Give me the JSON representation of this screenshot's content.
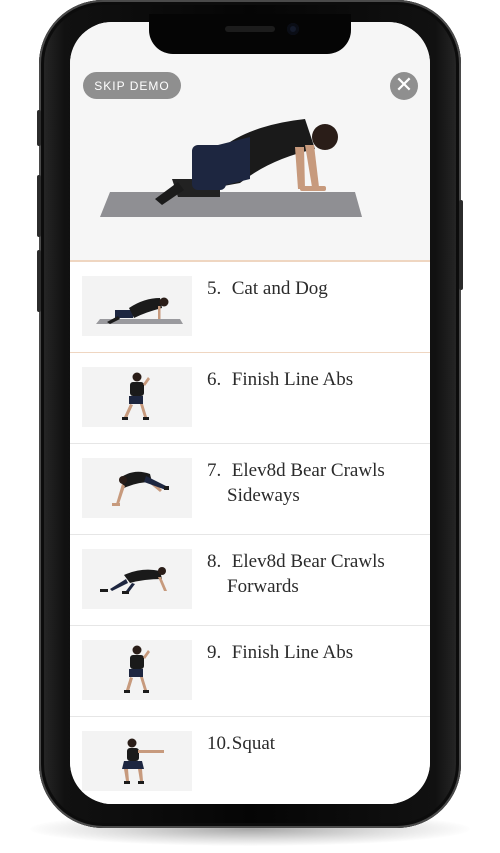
{
  "hero": {
    "skip_label": "SKIP DEMO",
    "close_icon": "close-icon",
    "current_exercise_icon": "person-cat-dog-pose"
  },
  "exercises": [
    {
      "number": "5.",
      "name": "Cat and Dog",
      "name_line2": "",
      "active": true
    },
    {
      "number": "6.",
      "name": "Finish Line Abs",
      "name_line2": "",
      "active": false
    },
    {
      "number": "7.",
      "name": "Elev8d Bear Crawls",
      "name_line2": "Sideways",
      "active": false
    },
    {
      "number": "8.",
      "name": "Elev8d Bear Crawls",
      "name_line2": "Forwards",
      "active": false
    },
    {
      "number": "9.",
      "name": "Finish Line Abs",
      "name_line2": "",
      "active": false
    },
    {
      "number": "10.",
      "name": "Squat",
      "name_line2": "",
      "active": false
    }
  ],
  "colors": {
    "active_border": "#efd6c1",
    "button_gray": "#8f8f8f",
    "text": "#2b2b2b"
  }
}
